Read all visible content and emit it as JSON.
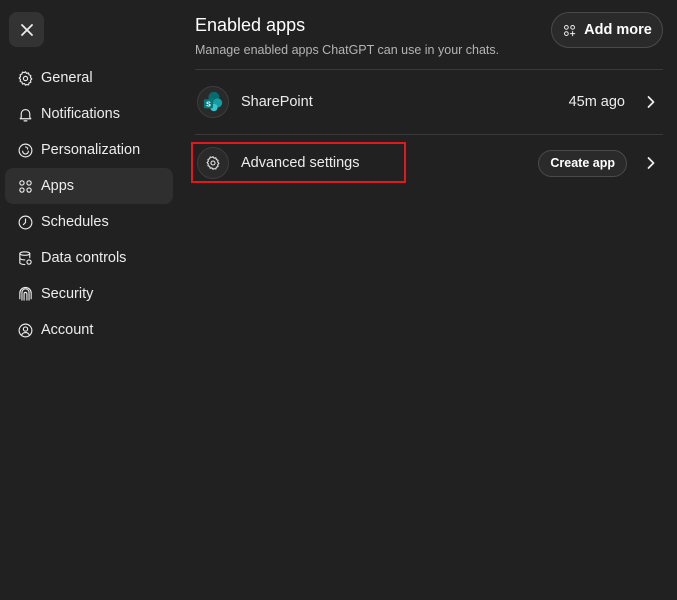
{
  "close": {
    "icon": "close-icon"
  },
  "sidebar": {
    "items": [
      {
        "label": "General",
        "icon": "gear-icon",
        "active": false
      },
      {
        "label": "Notifications",
        "icon": "bell-icon",
        "active": false
      },
      {
        "label": "Personalization",
        "icon": "personalization-icon",
        "active": false
      },
      {
        "label": "Apps",
        "icon": "apps-grid-icon",
        "active": true
      },
      {
        "label": "Schedules",
        "icon": "clock-icon",
        "active": false
      },
      {
        "label": "Data controls",
        "icon": "database-icon",
        "active": false
      },
      {
        "label": "Security",
        "icon": "shield-icon",
        "active": false
      },
      {
        "label": "Account",
        "icon": "user-circle-icon",
        "active": false
      }
    ]
  },
  "main": {
    "title": "Enabled apps",
    "subtitle": "Manage enabled apps ChatGPT can use in your chats.",
    "add_more_label": "Add more",
    "apps": [
      {
        "name": "SharePoint",
        "time": "45m ago",
        "icon": "sharepoint-icon"
      }
    ],
    "advanced": {
      "label": "Advanced settings",
      "create_label": "Create app",
      "icon": "gear-icon"
    }
  },
  "colors": {
    "background": "#212121",
    "active_nav": "#2f2f2f",
    "highlight": "#e0191c"
  }
}
